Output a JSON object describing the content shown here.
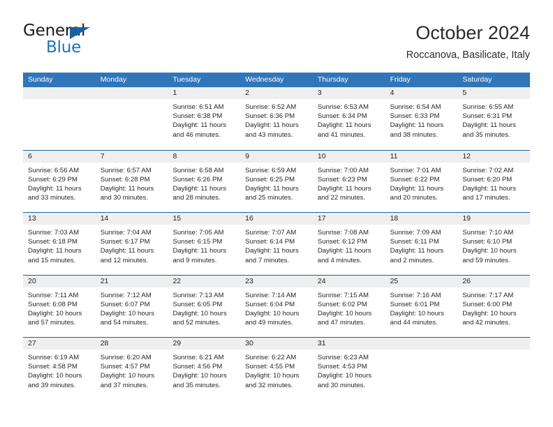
{
  "brand": {
    "name_top": "General",
    "name_bottom": "Blue",
    "accent_color": "#1f74bd",
    "triangle_color": "#1463a5"
  },
  "header": {
    "month_title": "October 2024",
    "location": "Roccanova, Basilicate, Italy"
  },
  "calendar": {
    "header_bg": "#3076b8",
    "row_rule_color": "#1463a5",
    "date_strip_bg": "#efefef",
    "weekdays": [
      "Sunday",
      "Monday",
      "Tuesday",
      "Wednesday",
      "Thursday",
      "Friday",
      "Saturday"
    ],
    "weeks": [
      [
        {
          "date": "",
          "lines": []
        },
        {
          "date": "",
          "lines": []
        },
        {
          "date": "1",
          "lines": [
            "Sunrise: 6:51 AM",
            "Sunset: 6:38 PM",
            "Daylight: 11 hours",
            "and 46 minutes."
          ]
        },
        {
          "date": "2",
          "lines": [
            "Sunrise: 6:52 AM",
            "Sunset: 6:36 PM",
            "Daylight: 11 hours",
            "and 43 minutes."
          ]
        },
        {
          "date": "3",
          "lines": [
            "Sunrise: 6:53 AM",
            "Sunset: 6:34 PM",
            "Daylight: 11 hours",
            "and 41 minutes."
          ]
        },
        {
          "date": "4",
          "lines": [
            "Sunrise: 6:54 AM",
            "Sunset: 6:33 PM",
            "Daylight: 11 hours",
            "and 38 minutes."
          ]
        },
        {
          "date": "5",
          "lines": [
            "Sunrise: 6:55 AM",
            "Sunset: 6:31 PM",
            "Daylight: 11 hours",
            "and 35 minutes."
          ]
        }
      ],
      [
        {
          "date": "6",
          "lines": [
            "Sunrise: 6:56 AM",
            "Sunset: 6:29 PM",
            "Daylight: 11 hours",
            "and 33 minutes."
          ]
        },
        {
          "date": "7",
          "lines": [
            "Sunrise: 6:57 AM",
            "Sunset: 6:28 PM",
            "Daylight: 11 hours",
            "and 30 minutes."
          ]
        },
        {
          "date": "8",
          "lines": [
            "Sunrise: 6:58 AM",
            "Sunset: 6:26 PM",
            "Daylight: 11 hours",
            "and 28 minutes."
          ]
        },
        {
          "date": "9",
          "lines": [
            "Sunrise: 6:59 AM",
            "Sunset: 6:25 PM",
            "Daylight: 11 hours",
            "and 25 minutes."
          ]
        },
        {
          "date": "10",
          "lines": [
            "Sunrise: 7:00 AM",
            "Sunset: 6:23 PM",
            "Daylight: 11 hours",
            "and 22 minutes."
          ]
        },
        {
          "date": "11",
          "lines": [
            "Sunrise: 7:01 AM",
            "Sunset: 6:22 PM",
            "Daylight: 11 hours",
            "and 20 minutes."
          ]
        },
        {
          "date": "12",
          "lines": [
            "Sunrise: 7:02 AM",
            "Sunset: 6:20 PM",
            "Daylight: 11 hours",
            "and 17 minutes."
          ]
        }
      ],
      [
        {
          "date": "13",
          "lines": [
            "Sunrise: 7:03 AM",
            "Sunset: 6:18 PM",
            "Daylight: 11 hours",
            "and 15 minutes."
          ]
        },
        {
          "date": "14",
          "lines": [
            "Sunrise: 7:04 AM",
            "Sunset: 6:17 PM",
            "Daylight: 11 hours",
            "and 12 minutes."
          ]
        },
        {
          "date": "15",
          "lines": [
            "Sunrise: 7:05 AM",
            "Sunset: 6:15 PM",
            "Daylight: 11 hours",
            "and 9 minutes."
          ]
        },
        {
          "date": "16",
          "lines": [
            "Sunrise: 7:07 AM",
            "Sunset: 6:14 PM",
            "Daylight: 11 hours",
            "and 7 minutes."
          ]
        },
        {
          "date": "17",
          "lines": [
            "Sunrise: 7:08 AM",
            "Sunset: 6:12 PM",
            "Daylight: 11 hours",
            "and 4 minutes."
          ]
        },
        {
          "date": "18",
          "lines": [
            "Sunrise: 7:09 AM",
            "Sunset: 6:11 PM",
            "Daylight: 11 hours",
            "and 2 minutes."
          ]
        },
        {
          "date": "19",
          "lines": [
            "Sunrise: 7:10 AM",
            "Sunset: 6:10 PM",
            "Daylight: 10 hours",
            "and 59 minutes."
          ]
        }
      ],
      [
        {
          "date": "20",
          "lines": [
            "Sunrise: 7:11 AM",
            "Sunset: 6:08 PM",
            "Daylight: 10 hours",
            "and 57 minutes."
          ]
        },
        {
          "date": "21",
          "lines": [
            "Sunrise: 7:12 AM",
            "Sunset: 6:07 PM",
            "Daylight: 10 hours",
            "and 54 minutes."
          ]
        },
        {
          "date": "22",
          "lines": [
            "Sunrise: 7:13 AM",
            "Sunset: 6:05 PM",
            "Daylight: 10 hours",
            "and 52 minutes."
          ]
        },
        {
          "date": "23",
          "lines": [
            "Sunrise: 7:14 AM",
            "Sunset: 6:04 PM",
            "Daylight: 10 hours",
            "and 49 minutes."
          ]
        },
        {
          "date": "24",
          "lines": [
            "Sunrise: 7:15 AM",
            "Sunset: 6:02 PM",
            "Daylight: 10 hours",
            "and 47 minutes."
          ]
        },
        {
          "date": "25",
          "lines": [
            "Sunrise: 7:16 AM",
            "Sunset: 6:01 PM",
            "Daylight: 10 hours",
            "and 44 minutes."
          ]
        },
        {
          "date": "26",
          "lines": [
            "Sunrise: 7:17 AM",
            "Sunset: 6:00 PM",
            "Daylight: 10 hours",
            "and 42 minutes."
          ]
        }
      ],
      [
        {
          "date": "27",
          "lines": [
            "Sunrise: 6:19 AM",
            "Sunset: 4:58 PM",
            "Daylight: 10 hours",
            "and 39 minutes."
          ]
        },
        {
          "date": "28",
          "lines": [
            "Sunrise: 6:20 AM",
            "Sunset: 4:57 PM",
            "Daylight: 10 hours",
            "and 37 minutes."
          ]
        },
        {
          "date": "29",
          "lines": [
            "Sunrise: 6:21 AM",
            "Sunset: 4:56 PM",
            "Daylight: 10 hours",
            "and 35 minutes."
          ]
        },
        {
          "date": "30",
          "lines": [
            "Sunrise: 6:22 AM",
            "Sunset: 4:55 PM",
            "Daylight: 10 hours",
            "and 32 minutes."
          ]
        },
        {
          "date": "31",
          "lines": [
            "Sunrise: 6:23 AM",
            "Sunset: 4:53 PM",
            "Daylight: 10 hours",
            "and 30 minutes."
          ]
        },
        {
          "date": "",
          "lines": []
        },
        {
          "date": "",
          "lines": []
        }
      ]
    ]
  }
}
